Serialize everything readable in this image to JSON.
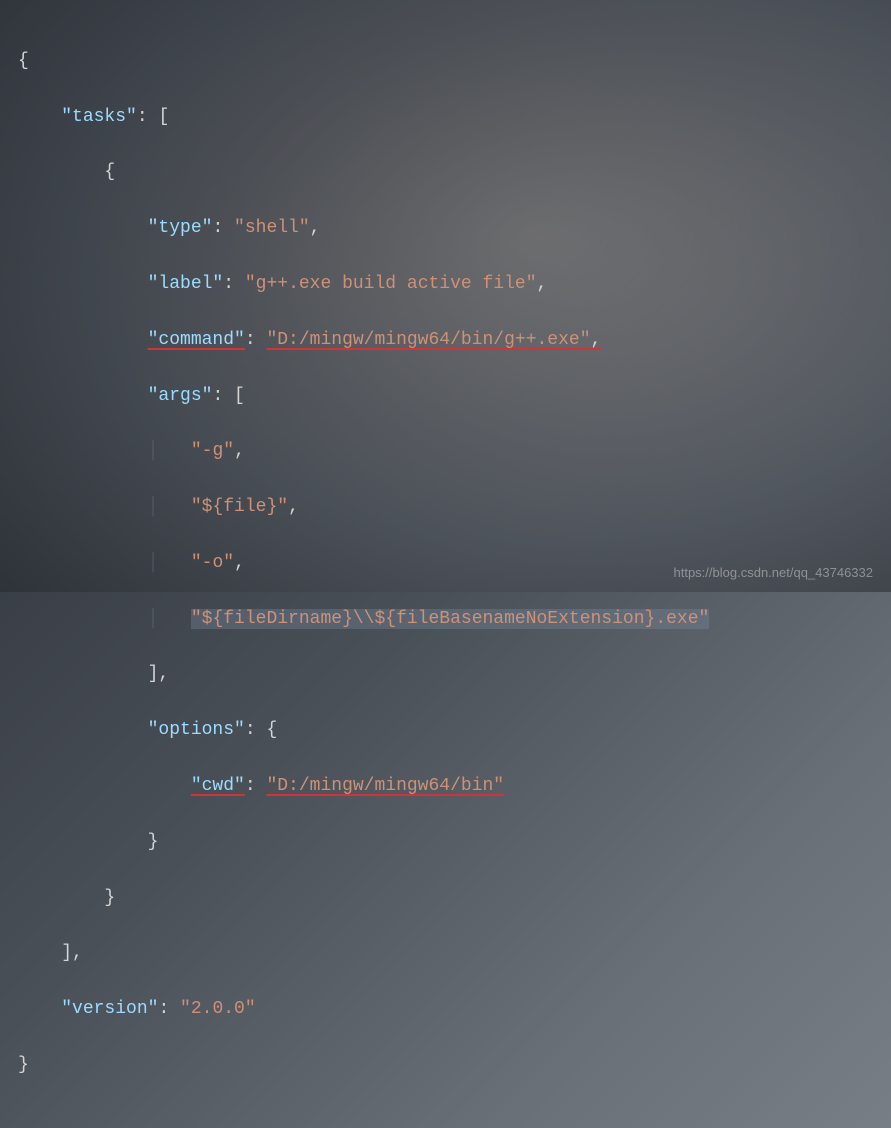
{
  "code": {
    "tasks_key": "\"tasks\"",
    "type_key": "\"type\"",
    "type_val": "\"shell\"",
    "label_key": "\"label\"",
    "label_val": "\"g++.exe build active file\"",
    "command_key": "\"command\"",
    "command_val": "\"D:/mingw/mingw64/bin/g++.exe\"",
    "args_key": "\"args\"",
    "arg0": "\"-g\"",
    "arg1": "\"${file}\"",
    "arg2": "\"-o\"",
    "arg3": "\"${fileDirname}\\\\${fileBasenameNoExtension}.exe\"",
    "options_key": "\"options\"",
    "cwd_key": "\"cwd\"",
    "cwd_val": "\"D:/mingw/mingw64/bin\"",
    "version_key": "\"version\"",
    "version_val": "\"2.0.0\""
  },
  "watermark": "https://blog.csdn.net/qq_43746332"
}
